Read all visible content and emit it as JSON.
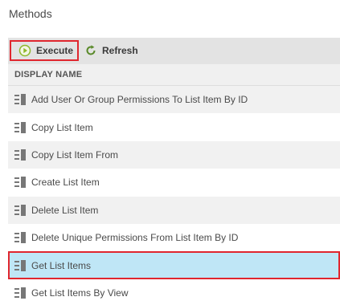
{
  "panel": {
    "title": "Methods"
  },
  "toolbar": {
    "execute_label": "Execute",
    "refresh_label": "Refresh"
  },
  "table": {
    "column_header": "DISPLAY NAME",
    "rows": [
      {
        "label": "Add User Or Group Permissions To List Item By ID"
      },
      {
        "label": "Copy List Item"
      },
      {
        "label": "Copy List Item From"
      },
      {
        "label": "Create List Item"
      },
      {
        "label": "Delete List Item"
      },
      {
        "label": "Delete Unique Permissions From List Item By ID"
      },
      {
        "label": "Get List Items"
      },
      {
        "label": "Get List Items By View"
      }
    ],
    "selected_row": "Get List Items"
  },
  "colors": {
    "highlight_border": "#e0262e",
    "selected_row_bg": "#bfe6f6",
    "execute_icon": "#8fb82a",
    "refresh_icon": "#5a8a2a"
  },
  "icons": {
    "execute": "play-circle-icon",
    "refresh": "refresh-icon",
    "method": "method-list-icon"
  }
}
